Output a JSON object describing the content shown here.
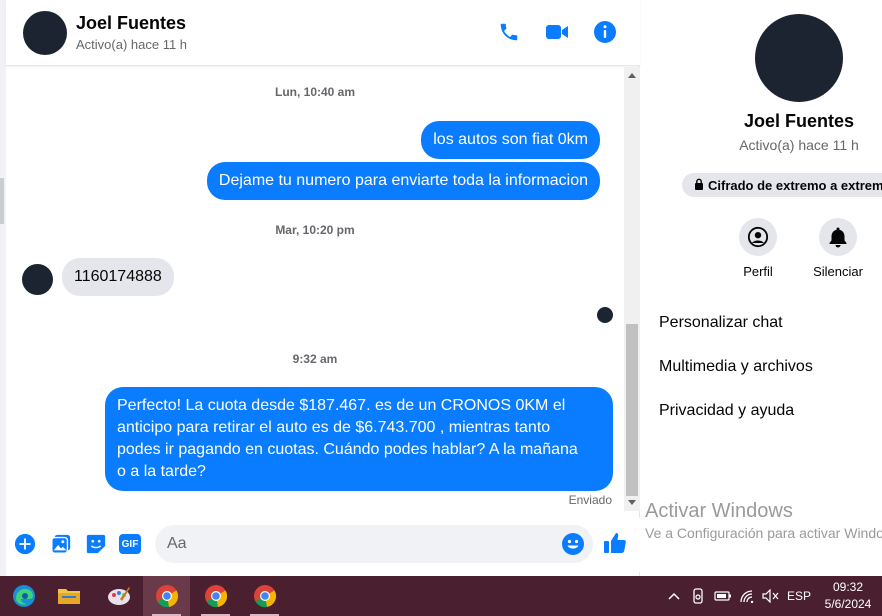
{
  "contact": {
    "name": "Joel Fuentes",
    "status": "Activo(a) hace 11 h"
  },
  "header_actions": [
    "phone-icon",
    "video-icon",
    "info-icon"
  ],
  "messages": {
    "ts1": "Lun, 10:40 am",
    "m1": "los autos son fiat 0km",
    "m2": "Dejame tu numero para enviarte toda la informacion",
    "ts2": "Mar, 10:20 pm",
    "m3": "1160174888",
    "ts3": "9:32 am",
    "m4_lines": [
      "Perfecto! La cuota desde $187.467. es de un CRONOS 0KM el",
      "anticipo para retirar el auto es de $6.743.700 , mientras tanto",
      "podes ir pagando en cuotas. Cuándo podes hablar? A la mañana",
      "o a la tarde?"
    ],
    "delivery_status": "Enviado"
  },
  "composer": {
    "placeholder": "Aa",
    "gif_label": "GIF"
  },
  "sidebar": {
    "name": "Joel Fuentes",
    "status": "Activo(a) hace 11 h",
    "encryption": "Cifrado de extremo a extremo",
    "profile_label": "Perfil",
    "mute_label": "Silenciar",
    "menu": [
      "Personalizar chat",
      "Multimedia y archivos",
      "Privacidad y ayuda"
    ]
  },
  "watermark": {
    "title": "Activar Windows",
    "subtitle": "Ve a Configuración para activar Windows."
  },
  "taskbar": {
    "apps": [
      "edge-icon",
      "file-explorer-icon",
      "paint-icon",
      "chrome-icon",
      "chrome-icon",
      "chrome-icon"
    ],
    "language": "ESP",
    "time": "09:32",
    "date": "5/6/2024"
  },
  "colors": {
    "accent": "#0a7cff",
    "incoming_bubble": "#e4e6eb",
    "taskbar": "#4a2030"
  }
}
